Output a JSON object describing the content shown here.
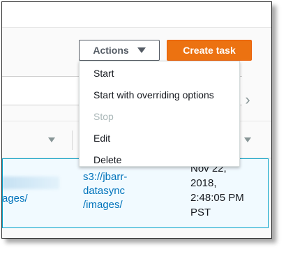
{
  "toolbar": {
    "actions_label": "Actions",
    "create_task_label": "Create task"
  },
  "actions_menu": {
    "items": [
      {
        "label": "Start",
        "disabled": false
      },
      {
        "label": "Start with overriding options",
        "disabled": false
      },
      {
        "label": "Stop",
        "disabled": true
      },
      {
        "label": "Edit",
        "disabled": false
      },
      {
        "label": "Delete",
        "disabled": false
      }
    ]
  },
  "table": {
    "selected_row": {
      "source_location_tail": "ages/",
      "destination_location": [
        "s3://jbarr-",
        "datasync",
        "/images/"
      ],
      "creation_time": [
        "Nov 22,",
        "2018,",
        "2:48:05 PM",
        "PST"
      ]
    }
  },
  "colors": {
    "accent": "#ec7211",
    "link": "#0073bb",
    "selected_row_bg": "#f1faff",
    "selected_row_border": "#00a1c9"
  }
}
